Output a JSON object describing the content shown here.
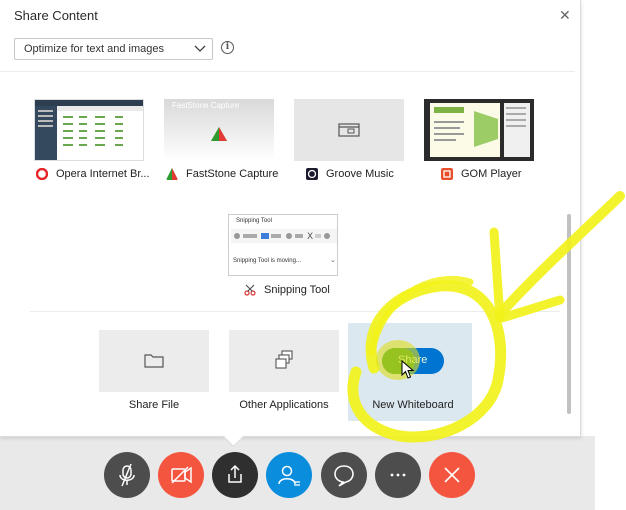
{
  "dialog": {
    "title": "Share Content",
    "optimize_select": {
      "value": "Optimize for text and images"
    }
  },
  "applications": [
    {
      "label": "Opera Internet Br..."
    },
    {
      "label": "FastStone Capture"
    },
    {
      "label": "Groove Music"
    },
    {
      "label": "GOM Player"
    },
    {
      "label": "Snipping Tool"
    }
  ],
  "thumbnails": {
    "faststone_caption": "FastStone Capture",
    "snipping_title": "Snipping Tool",
    "snipping_status": "Snipping Tool is moving..."
  },
  "share_options": [
    {
      "label": "Share File"
    },
    {
      "label": "Other Applications"
    },
    {
      "label": "New Whiteboard"
    }
  ],
  "share_toggle": {
    "label": "Share"
  },
  "control_bar": {
    "items": [
      "mute-microphone",
      "stop-video",
      "share-content",
      "participants",
      "chat",
      "more-options",
      "leave-meeting"
    ]
  },
  "colors": {
    "highlighter": "#f2f21b",
    "end_button": "#f4553f",
    "video_button": "#f4553f",
    "share_button": "#2f2f2f",
    "participants_button": "#0a8ddd",
    "dark_button": "#4d4d4d",
    "toggle_blue": "#0074d1",
    "toggle_green": "#2e9b2e"
  }
}
